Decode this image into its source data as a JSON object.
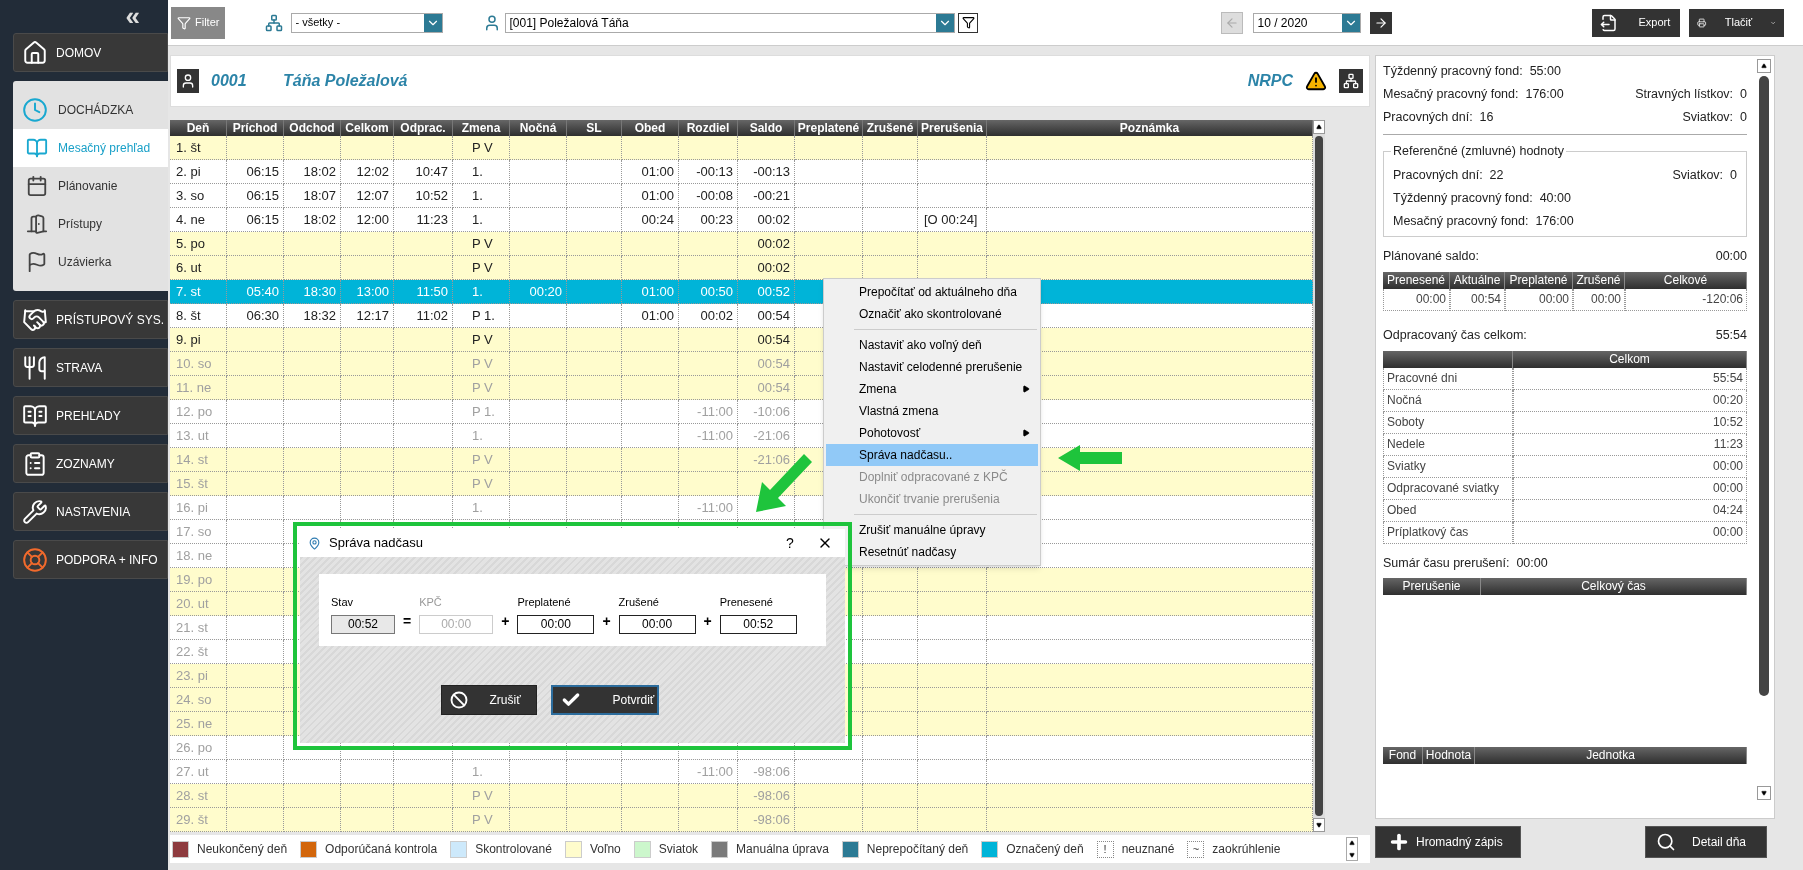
{
  "sidebar": {
    "collapse": "«",
    "items": [
      {
        "label": "DOMOV",
        "expanded": false
      },
      {
        "label": "DOCHÁDZKA",
        "expanded": true,
        "children": [
          {
            "label": "Mesačný prehľad",
            "selected": true
          },
          {
            "label": "Plánovanie",
            "selected": false
          },
          {
            "label": "Prístupy",
            "selected": false
          },
          {
            "label": "Uzávierka",
            "selected": false
          }
        ]
      },
      {
        "label": "PRÍSTUPOVÝ SYS.",
        "expanded": false
      },
      {
        "label": "STRAVA",
        "expanded": false
      },
      {
        "label": "PREHĽADY",
        "expanded": false
      },
      {
        "label": "ZOZNAMY",
        "expanded": false
      },
      {
        "label": "NASTAVENIA",
        "expanded": false
      },
      {
        "label": "PODPORA + INFO",
        "expanded": false
      }
    ]
  },
  "toolbar": {
    "filter_button": "Filter",
    "group_select": "- všetky -",
    "employee_select": "[001] Poležalová Táňa",
    "month_field": "10 / 2020",
    "prev_disabled": true,
    "export_button": "Export",
    "print_button": "Tlačiť"
  },
  "employee": {
    "number": "0001",
    "name": "Táňa Poležalová",
    "code": "NRPC"
  },
  "table": {
    "columns": [
      "Deň",
      "Príchod",
      "Odchod",
      "Celkom",
      "Odprac.",
      "Zmena",
      "Nočná",
      "SL",
      "Obed",
      "Rozdiel",
      "Saldo",
      "Preplatené",
      "Zrušené",
      "Prerušenia",
      "Poznámka"
    ],
    "rows": [
      {
        "day": "1. št",
        "shift": "P V",
        "free": true,
        "future": false,
        "selected": false
      },
      {
        "day": "2. pi",
        "arrival": "06:15",
        "departure": "18:02",
        "total": "12:02",
        "worked": "10:47",
        "shift": "1.",
        "lunch": "01:00",
        "diff": "-00:13",
        "balance": "-00:13",
        "free": false,
        "future": false,
        "selected": false
      },
      {
        "day": "3. so",
        "arrival": "06:15",
        "departure": "18:07",
        "total": "12:07",
        "worked": "10:52",
        "shift": "1.",
        "lunch": "01:00",
        "diff": "-00:08",
        "balance": "-00:21",
        "free": false,
        "future": false,
        "selected": false
      },
      {
        "day": "4. ne",
        "arrival": "06:15",
        "departure": "18:02",
        "total": "12:00",
        "worked": "11:23",
        "shift": "1.",
        "lunch": "00:24",
        "diff": "00:23",
        "balance": "00:02",
        "breaks": "[O 00:24]",
        "free": false,
        "future": false,
        "selected": false
      },
      {
        "day": "5. po",
        "shift": "P V",
        "balance": "00:02",
        "free": true,
        "future": false,
        "selected": false
      },
      {
        "day": "6. ut",
        "shift": "P V",
        "balance": "00:02",
        "free": true,
        "future": false,
        "selected": false
      },
      {
        "day": "7. st",
        "arrival": "05:40",
        "departure": "18:30",
        "total": "13:00",
        "worked": "11:50",
        "shift": "1.",
        "night": "00:20",
        "lunch": "01:00",
        "diff": "00:50",
        "balance": "00:52",
        "free": false,
        "future": false,
        "selected": true
      },
      {
        "day": "8. št",
        "arrival": "06:30",
        "departure": "18:32",
        "total": "12:17",
        "worked": "11:02",
        "shift": "P 1.",
        "lunch": "01:00",
        "diff": "00:02",
        "balance": "00:54",
        "free": false,
        "future": false,
        "selected": false
      },
      {
        "day": "9. pi",
        "shift": "P V",
        "balance": "00:54",
        "free": true,
        "future": false,
        "selected": false
      },
      {
        "day": "10. so",
        "shift": "P V",
        "balance": "00:54",
        "free": true,
        "future": true,
        "selected": false
      },
      {
        "day": "11. ne",
        "shift": "P V",
        "balance": "00:54",
        "free": true,
        "future": true,
        "selected": false
      },
      {
        "day": "12. po",
        "shift": "P 1.",
        "diff": "-11:00",
        "balance": "-10:06",
        "free": false,
        "future": true,
        "selected": false
      },
      {
        "day": "13. ut",
        "shift": "1.",
        "diff": "-11:00",
        "balance": "-21:06",
        "free": false,
        "future": true,
        "selected": false
      },
      {
        "day": "14. st",
        "shift": "P V",
        "balance": "-21:06",
        "free": true,
        "future": true,
        "selected": false
      },
      {
        "day": "15. št",
        "shift": "P V",
        "free": true,
        "future": true,
        "selected": false
      },
      {
        "day": "16. pi",
        "shift": "1.",
        "diff": "-11:00",
        "free": false,
        "future": true,
        "selected": false
      },
      {
        "day": "17. so",
        "free": false,
        "future": true,
        "selected": false
      },
      {
        "day": "18. ne",
        "free": false,
        "future": true,
        "selected": false
      },
      {
        "day": "19. po",
        "free": true,
        "future": true,
        "selected": false
      },
      {
        "day": "20. ut",
        "free": true,
        "future": true,
        "selected": false
      },
      {
        "day": "21. st",
        "free": false,
        "future": true,
        "selected": false
      },
      {
        "day": "22. št",
        "free": false,
        "future": true,
        "selected": false
      },
      {
        "day": "23. pi",
        "free": true,
        "future": true,
        "selected": false
      },
      {
        "day": "24. so",
        "free": true,
        "future": true,
        "selected": false
      },
      {
        "day": "25. ne",
        "free": true,
        "future": true,
        "selected": false
      },
      {
        "day": "26. po",
        "free": false,
        "future": true,
        "selected": false
      },
      {
        "day": "27. ut",
        "shift": "1.",
        "diff": "-11:00",
        "balance": "-98:06",
        "free": false,
        "future": true,
        "selected": false
      },
      {
        "day": "28. st",
        "shift": "P V",
        "balance": "-98:06",
        "free": true,
        "future": true,
        "selected": false
      },
      {
        "day": "29. št",
        "shift": "P V",
        "balance": "-98:06",
        "free": true,
        "future": true,
        "selected": false
      }
    ]
  },
  "legend": [
    {
      "kind": "swatch",
      "label": "Neukončený deň",
      "color": "#8e3b3f"
    },
    {
      "kind": "swatch",
      "label": "Odporúčaná kontrola",
      "color": "#d2660c"
    },
    {
      "kind": "swatch",
      "label": "Skontrolované",
      "color": "#cde9fb"
    },
    {
      "kind": "swatch",
      "label": "Voľno",
      "color": "#fffccc"
    },
    {
      "kind": "swatch",
      "label": "Sviatok",
      "color": "#ccf7cc"
    },
    {
      "kind": "swatch",
      "label": "Manuálna úprava",
      "color": "#7a7a7a"
    },
    {
      "kind": "swatch",
      "label": "Neprepočítaný deň",
      "color": "#2c7a94"
    },
    {
      "kind": "swatch",
      "label": "Označený deň",
      "color": "#00b4d8"
    },
    {
      "kind": "symbol",
      "symbol": "!",
      "label": "neuznané"
    },
    {
      "kind": "symbol",
      "symbol": "~",
      "label": "zaokrúhlenie"
    }
  ],
  "context_menu": [
    {
      "kind": "item",
      "label": "Prepočítať od aktuálneho dňa",
      "selected": false,
      "disabled": false,
      "submenu": false
    },
    {
      "kind": "item",
      "label": "Označiť ako skontrolované",
      "selected": false,
      "disabled": false,
      "submenu": false
    },
    {
      "kind": "separator"
    },
    {
      "kind": "item",
      "label": "Nastaviť ako voľný deň",
      "selected": false,
      "disabled": false,
      "submenu": false
    },
    {
      "kind": "item",
      "label": "Nastaviť celodenné prerušenie",
      "selected": false,
      "disabled": false,
      "submenu": false
    },
    {
      "kind": "item",
      "label": "Zmena",
      "selected": false,
      "disabled": false,
      "submenu": true
    },
    {
      "kind": "item",
      "label": "Vlastná zmena",
      "selected": false,
      "disabled": false,
      "submenu": false
    },
    {
      "kind": "item",
      "label": "Pohotovosť",
      "selected": false,
      "disabled": false,
      "submenu": true
    },
    {
      "kind": "item",
      "label": "Správa nadčasu..",
      "selected": true,
      "disabled": false,
      "submenu": false
    },
    {
      "kind": "item",
      "label": "Doplniť odpracované z KPČ",
      "selected": false,
      "disabled": true,
      "submenu": false
    },
    {
      "kind": "item",
      "label": "Ukončiť trvanie prerušenia",
      "selected": false,
      "disabled": true,
      "submenu": false
    },
    {
      "kind": "separator"
    },
    {
      "kind": "item",
      "label": "Zrušiť manuálne úpravy",
      "selected": false,
      "disabled": false,
      "submenu": false
    },
    {
      "kind": "item",
      "label": "Resetnúť nadčasy",
      "selected": false,
      "disabled": false,
      "submenu": false
    }
  ],
  "dialog": {
    "title": "Správa nadčasu",
    "help": "?",
    "fields": [
      {
        "label": "Stav",
        "value": "00:52",
        "kind": "readonly"
      },
      {
        "label": "KPČ",
        "value": "00:00",
        "kind": "disabled",
        "operator": "="
      },
      {
        "label": "Preplatené",
        "value": "00:00",
        "kind": "input",
        "operator": "+"
      },
      {
        "label": "Zrušené",
        "value": "00:00",
        "kind": "input",
        "operator": "+"
      },
      {
        "label": "Prenesené",
        "value": "00:52",
        "kind": "input",
        "operator": "+"
      }
    ],
    "buttons": [
      {
        "label": "Zrušiť",
        "kind": "cancel"
      },
      {
        "label": "Potvrdiť",
        "kind": "confirm"
      }
    ]
  },
  "right_panel": {
    "summary": [
      [
        {
          "label": "Týždenný pracovný fond:",
          "value": "55:00"
        }
      ],
      [
        {
          "label": "Mesačný pracovný fond:",
          "value": "176:00"
        },
        {
          "label": "Stravných lístkov:",
          "value": "0"
        }
      ],
      [
        {
          "label": "Pracovných dní:",
          "value": "16"
        },
        {
          "label": "Sviatkov:",
          "value": "0"
        }
      ]
    ],
    "reference": {
      "title": "Referenčné (zmluvné) hodnoty",
      "rows": [
        [
          {
            "label": "Pracovných dní:",
            "value": "22"
          },
          {
            "label": "Sviatkov:",
            "value": "0"
          }
        ],
        [
          {
            "label": "Týždenný pracovný fond:",
            "value": "40:00"
          }
        ],
        [
          {
            "label": "Mesačný pracovný fond:",
            "value": "176:00"
          }
        ]
      ]
    },
    "planned": {
      "label": "Plánované saldo:",
      "value": "00:00",
      "columns": [
        "Prenesené",
        "Aktuálne",
        "Preplatené",
        "Zrušené",
        "Celkové"
      ],
      "rows": [
        [
          "00:00",
          "00:54",
          "00:00",
          "00:00",
          "-120:06"
        ]
      ]
    },
    "worked": {
      "label": "Odpracovaný čas celkom:",
      "value": "55:54",
      "columns": [
        "Celkom"
      ],
      "rows": [
        [
          "Pracovné dni",
          "55:54"
        ],
        [
          "Nočná",
          "00:20"
        ],
        [
          "Soboty",
          "10:52"
        ],
        [
          "Nedele",
          "11:23"
        ],
        [
          "Sviatky",
          "00:00"
        ],
        [
          "Odpracované sviatky",
          "00:00"
        ],
        [
          "Obed",
          "04:24"
        ],
        [
          "Príplatkový čas",
          "00:00"
        ]
      ]
    },
    "breaks": {
      "label": "Sumár času prerušení:",
      "value": "00:00",
      "columns": [
        "Prerušenie",
        "Celkový čas"
      ]
    },
    "funds": {
      "columns": [
        "Fond",
        "Hodnota",
        "Jednotka"
      ]
    },
    "buttons": [
      "Hromadný zápis",
      "Detail dňa"
    ]
  }
}
